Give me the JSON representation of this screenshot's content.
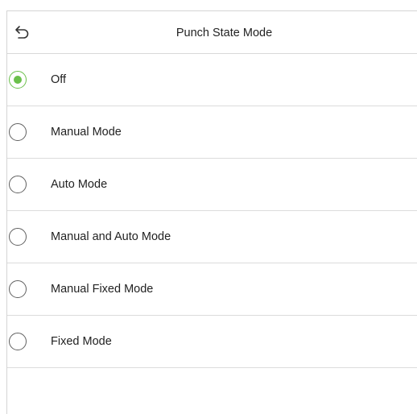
{
  "header": {
    "title": "Punch State Mode",
    "back_icon": "undo-arrow-icon"
  },
  "options": [
    {
      "label": "Off",
      "selected": true
    },
    {
      "label": "Manual Mode",
      "selected": false
    },
    {
      "label": "Auto Mode",
      "selected": false
    },
    {
      "label": "Manual and Auto Mode",
      "selected": false
    },
    {
      "label": "Manual Fixed Mode",
      "selected": false
    },
    {
      "label": "Fixed Mode",
      "selected": false
    }
  ],
  "colors": {
    "accent": "#6bc04b",
    "radio_border": "#5f5f5f",
    "divider": "#dcdcdc",
    "text": "#222222"
  }
}
